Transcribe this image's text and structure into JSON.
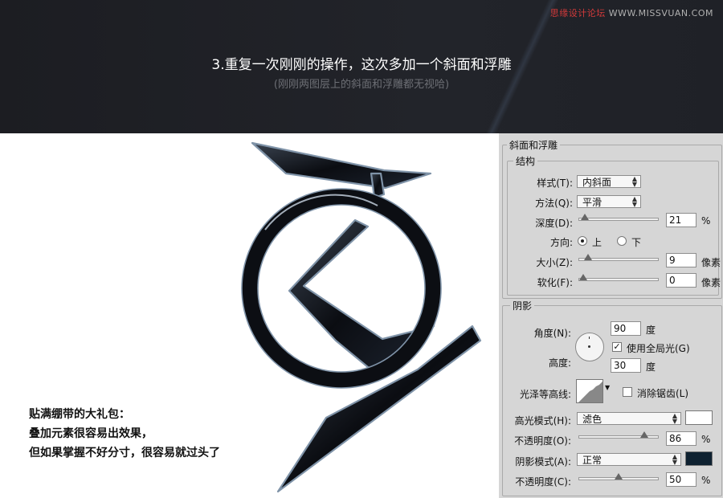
{
  "banner": {
    "watermark_prefix": "思缘设计论坛",
    "watermark_url": "WWW.MISSVUAN.COM",
    "title": "3.重复一次刚刚的操作，这次多加一个斜面和浮雕",
    "subtitle": "(刚刚两图层上的斜面和浮雕都无视哈)"
  },
  "caption": {
    "line1": "贴满绷带的大礼包：",
    "line2": "叠加元素很容易出效果，",
    "line3": "但如果掌握不好分寸，很容易就过头了"
  },
  "panel": {
    "title": "斜面和浮雕",
    "structure": {
      "legend": "结构",
      "style_label": "样式(T):",
      "style_value": "内斜面",
      "technique_label": "方法(Q):",
      "technique_value": "平滑",
      "depth_label": "深度(D):",
      "depth_value": "21",
      "depth_unit": "%",
      "depth_level": 0.02,
      "direction_label": "方向:",
      "direction_up": "上",
      "direction_down": "下",
      "direction_selected": "上",
      "size_label": "大小(Z):",
      "size_value": "9",
      "size_unit": "像素",
      "size_level": 0.07,
      "soften_label": "软化(F):",
      "soften_value": "0",
      "soften_unit": "像素",
      "soften_level": 0.0
    },
    "shading": {
      "legend": "阴影",
      "angle_label": "角度(N):",
      "angle_value": "90",
      "angle_unit": "度",
      "global_light_label": "使用全局光(G)",
      "global_light_checked": true,
      "altitude_label": "高度:",
      "altitude_value": "30",
      "altitude_unit": "度",
      "gloss_label": "光泽等高线:",
      "antialias_label": "消除锯齿(L)",
      "antialias_checked": false,
      "highlight_mode_label": "高光模式(H):",
      "highlight_mode_value": "滤色",
      "highlight_color": "#ffffff",
      "highlight_opacity_label": "不透明度(O):",
      "highlight_opacity_value": "86",
      "highlight_opacity_unit": "%",
      "highlight_opacity_level": 0.86,
      "shadow_mode_label": "阴影模式(A):",
      "shadow_mode_value": "正常",
      "shadow_color": "#0e2130",
      "shadow_opacity_label": "不透明度(C):",
      "shadow_opacity_value": "50",
      "shadow_opacity_unit": "%",
      "shadow_opacity_level": 0.5
    }
  }
}
